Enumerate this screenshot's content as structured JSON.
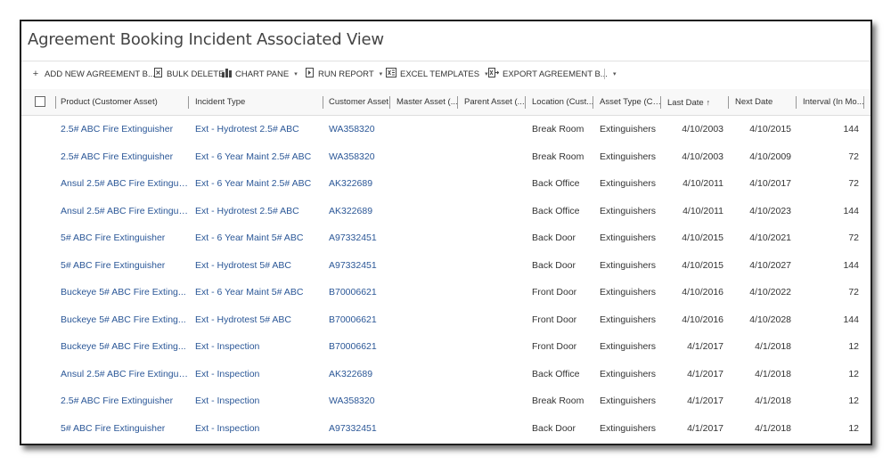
{
  "view": {
    "title": "Agreement Booking Incident Associated View",
    "title_chevron": "⌄"
  },
  "toolbar": {
    "add_new": "ADD NEW AGREEMENT B...",
    "bulk_delete": "BULK DELETE",
    "chart_pane": "CHART PANE",
    "run_report": "RUN REPORT",
    "excel_templates": "EXCEL TEMPLATES",
    "export": "EXPORT AGREEMENT B...",
    "caret": "▾"
  },
  "columns": {
    "product": "Product (Customer Asset)",
    "incident_type": "Incident Type",
    "customer_asset": "Customer Asset",
    "master_asset": "Master Asset (...",
    "parent_asset": "Parent Asset (...",
    "location": "Location (Cust...",
    "asset_type": "Asset Type (Cu...",
    "last_date": "Last Date",
    "last_date_sort": "↑",
    "next_date": "Next Date",
    "interval": "Interval (In Mo..."
  },
  "rows": [
    {
      "product": "2.5# ABC Fire Extinguisher",
      "incident_type": "Ext - Hydrotest 2.5# ABC",
      "customer_asset": "WA358320",
      "location": "Break Room",
      "asset_type": "Extinguishers",
      "last_date": "4/10/2003",
      "next_date": "4/10/2015",
      "interval": "144"
    },
    {
      "product": "2.5# ABC Fire Extinguisher",
      "incident_type": "Ext - 6 Year Maint 2.5# ABC",
      "customer_asset": "WA358320",
      "location": "Break Room",
      "asset_type": "Extinguishers",
      "last_date": "4/10/2003",
      "next_date": "4/10/2009",
      "interval": "72"
    },
    {
      "product": "Ansul 2.5# ABC Fire Extingui...",
      "incident_type": "Ext - 6 Year Maint 2.5# ABC",
      "customer_asset": "AK322689",
      "location": "Back Office",
      "asset_type": "Extinguishers",
      "last_date": "4/10/2011",
      "next_date": "4/10/2017",
      "interval": "72"
    },
    {
      "product": "Ansul 2.5# ABC Fire Extingui...",
      "incident_type": "Ext - Hydrotest 2.5# ABC",
      "customer_asset": "AK322689",
      "location": "Back Office",
      "asset_type": "Extinguishers",
      "last_date": "4/10/2011",
      "next_date": "4/10/2023",
      "interval": "144"
    },
    {
      "product": "5# ABC Fire Extinguisher",
      "incident_type": "Ext - 6 Year Maint 5# ABC",
      "customer_asset": "A97332451",
      "location": "Back Door",
      "asset_type": "Extinguishers",
      "last_date": "4/10/2015",
      "next_date": "4/10/2021",
      "interval": "72"
    },
    {
      "product": "5# ABC Fire Extinguisher",
      "incident_type": "Ext - Hydrotest 5# ABC",
      "customer_asset": "A97332451",
      "location": "Back Door",
      "asset_type": "Extinguishers",
      "last_date": "4/10/2015",
      "next_date": "4/10/2027",
      "interval": "144"
    },
    {
      "product": "Buckeye 5# ABC Fire Exting...",
      "incident_type": "Ext - 6 Year Maint 5# ABC",
      "customer_asset": "B70006621",
      "location": "Front Door",
      "asset_type": "Extinguishers",
      "last_date": "4/10/2016",
      "next_date": "4/10/2022",
      "interval": "72"
    },
    {
      "product": "Buckeye 5# ABC Fire Exting...",
      "incident_type": "Ext - Hydrotest 5# ABC",
      "customer_asset": "B70006621",
      "location": "Front Door",
      "asset_type": "Extinguishers",
      "last_date": "4/10/2016",
      "next_date": "4/10/2028",
      "interval": "144"
    },
    {
      "product": "Buckeye 5# ABC Fire Exting...",
      "incident_type": "Ext - Inspection",
      "customer_asset": "B70006621",
      "location": "Front Door",
      "asset_type": "Extinguishers",
      "last_date": "4/1/2017",
      "next_date": "4/1/2018",
      "interval": "12"
    },
    {
      "product": "Ansul 2.5# ABC Fire Extingui...",
      "incident_type": "Ext - Inspection",
      "customer_asset": "AK322689",
      "location": "Back Office",
      "asset_type": "Extinguishers",
      "last_date": "4/1/2017",
      "next_date": "4/1/2018",
      "interval": "12"
    },
    {
      "product": "2.5# ABC Fire Extinguisher",
      "incident_type": "Ext - Inspection",
      "customer_asset": "WA358320",
      "location": "Break Room",
      "asset_type": "Extinguishers",
      "last_date": "4/1/2017",
      "next_date": "4/1/2018",
      "interval": "12"
    },
    {
      "product": "5# ABC Fire Extinguisher",
      "incident_type": "Ext - Inspection",
      "customer_asset": "A97332451",
      "location": "Back Door",
      "asset_type": "Extinguishers",
      "last_date": "4/1/2017",
      "next_date": "4/1/2018",
      "interval": "12"
    }
  ]
}
